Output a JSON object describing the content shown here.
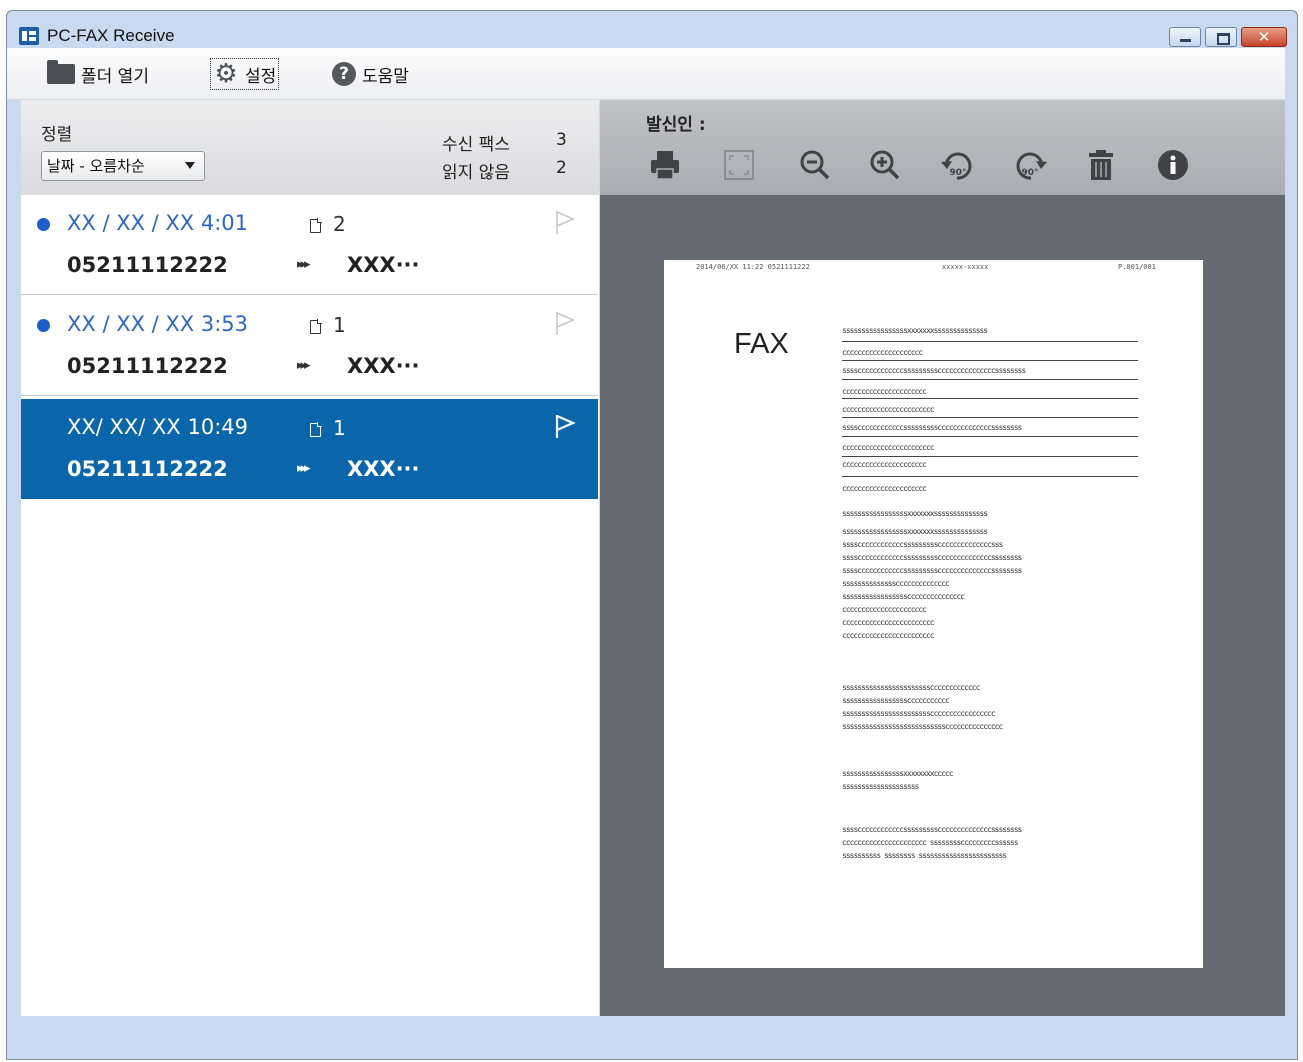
{
  "window": {
    "title": "PC-FAX Receive",
    "close_glyph": "✕"
  },
  "menu": {
    "open_folder": "폴더 열기",
    "settings": "설정",
    "help": "도움말"
  },
  "sort": {
    "label": "정렬",
    "selected": "날짜 - 오름차순"
  },
  "stats": {
    "received_label": "수신 팩스",
    "received_value": "3",
    "unread_label": "읽지 않음",
    "unread_value": "2"
  },
  "faxes": [
    {
      "date": "XX / XX / XX  4:01",
      "pages": "2",
      "number": "05211112222",
      "arrow": "▸▸▸",
      "sender": "XXX···",
      "unread": true,
      "selected": false
    },
    {
      "date": "XX / XX / XX  3:53",
      "pages": "1",
      "number": "05211112222",
      "arrow": "▸▸▸",
      "sender": "XXX···",
      "unread": true,
      "selected": false
    },
    {
      "date": "XX/ XX/ XX  10:49",
      "pages": "1",
      "number": "05211112222",
      "arrow": "▸▸▸",
      "sender": "XXX···",
      "unread": false,
      "selected": true
    }
  ],
  "preview": {
    "sender_label": "발신인 :",
    "tools": [
      "print-icon",
      "fit-page-icon",
      "zoom-out-icon",
      "zoom-in-icon",
      "rotate-left-90-icon",
      "rotate-right-90-icon",
      "delete-icon",
      "info-icon"
    ],
    "rotate_label": "90°",
    "page_title": "FAX",
    "page_header": [
      "2014/06/XX  11:22   0521111222",
      "xxxxx-xxxxx",
      "P.001/001"
    ],
    "page_lines": [
      "sssssssssssssssssxxxxxxxssssssssssssss",
      "ccccccccccccccccccccc",
      "ssssccccccccccccssssssssscccccccccccccccssssssss",
      "cccccccccccccccccccccc",
      "cccccccccccccccccccccccc",
      "ssssccccccccccccsssssssssccccccccccccccssssssss",
      "cccccccccccccccccccccccc",
      "cccccccccccccccccccccc",
      "cccccccccccccccccccccc",
      "sssssssssssssssssxxxxxxxssssssssssssss",
      "sssssssssssssssssxxxxxxxssssssssssssss",
      "ssssccccccccccccsssssssssccccccccccccccsss",
      "ssssccccccccccccsssssssssccccccccccccccssssssss",
      "ssssccccccccccccsssssssssccccccccccccccssssssss",
      "sssssssssssssscccccccccccccc",
      "sssssssssssssssssccccccccccccccc",
      "cccccccccccccccccccccc",
      "cccccccccccccccccccccccc",
      "cccccccccccccccccccccccc",
      "sssssssssssssssssssssssccccccccccccc",
      "sssssssssssssssssccccccccccc",
      "sssssssssssssssssssssssccccccccccccccccc",
      "sssssssssssssssssssssssssssccccccccccccccc",
      "ssssssssssssssssxxxxxxxxccccc",
      "ssssssssssssssssssss",
      "ssssccccccccccccsssssssssccccccccccccccssssssss",
      "cccccccccccccccccccccc    sssssssscccccccccssssss",
      "ssssssssss    ssssssss    sssssssssssssssssssssss"
    ]
  }
}
